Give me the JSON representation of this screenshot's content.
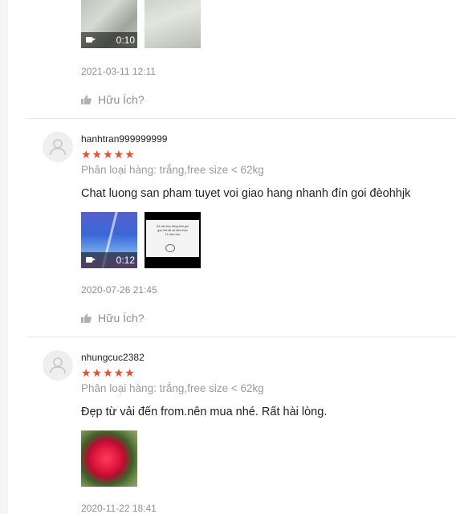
{
  "reviews": [
    {
      "timestamp": "2021-03-11 12:11",
      "video_duration": "0:10",
      "helpful_label": "Hữu Ích?"
    },
    {
      "username": "hanhtran999999999",
      "stars": "★★★★★",
      "rating": 5,
      "variant": "Phân loại hàng: trắng,free size < 62kg",
      "comment": "Chat luong san pham tuyet voi giao hang nhanh đín goi đèohhjk",
      "video_duration": "0:12",
      "image_caption": "84 cấu trúc tiếng Anh gói gọn hết tất cả kiến thức 12 năm học",
      "timestamp": "2020-07-26 21:45",
      "helpful_label": "Hữu Ích?"
    },
    {
      "username": "nhungcuc2382",
      "stars": "★★★★★",
      "rating": 5,
      "variant": "Phân loại hàng: trắng,free size < 62kg",
      "comment": "Đẹp từ vải đến from.nên  mua nhé. Rất hài lòng.",
      "timestamp": "2020-11-22 18:41"
    }
  ],
  "colors": {
    "star": "#ee4d2d",
    "muted": "#9b9b9b",
    "divider": "#e8e8e8"
  }
}
